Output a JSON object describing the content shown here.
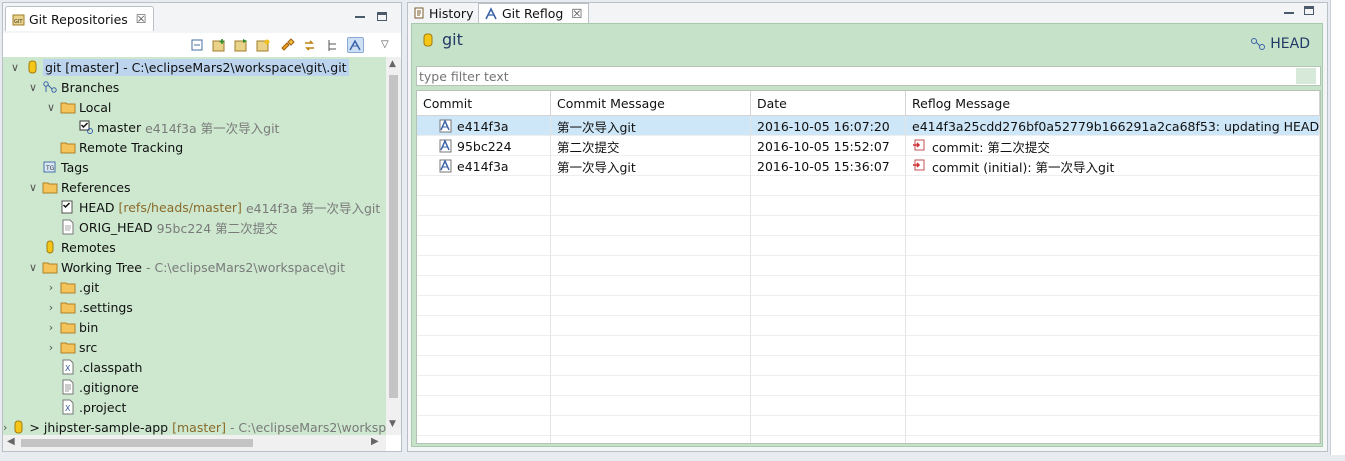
{
  "left_view": {
    "tab_title": "Git Repositories",
    "close_glyph": "☒",
    "toolbar_icons": [
      "collapse-all-icon",
      "add-repository-icon",
      "clone-repository-icon",
      "create-repository-icon",
      "link-with-editor-icon",
      "refresh-icon",
      "hierarchical-branch-icon",
      "link-selection-icon"
    ],
    "tree": [
      {
        "level": 0,
        "expander": "v",
        "icon": "repository-icon",
        "label": "git [master] - C:\\eclipseMars2\\workspace\\git\\.git",
        "decoration": "",
        "highlight": true
      },
      {
        "level": 1,
        "expander": "v",
        "icon": "branches-icon",
        "label": "Branches",
        "decoration": ""
      },
      {
        "level": 2,
        "expander": "v",
        "icon": "folder-icon",
        "label": "Local",
        "decoration": ""
      },
      {
        "level": 3,
        "expander": "",
        "icon": "checked-branch-icon",
        "label": "master",
        "decoration": "e414f3a 第一次导入git"
      },
      {
        "level": 2,
        "expander": "",
        "icon": "folder-icon",
        "label": "Remote Tracking",
        "decoration": ""
      },
      {
        "level": 1,
        "expander": "",
        "icon": "tags-icon",
        "label": "Tags",
        "decoration": ""
      },
      {
        "level": 1,
        "expander": "v",
        "icon": "folder-icon",
        "label": "References",
        "decoration": ""
      },
      {
        "level": 2,
        "expander": "",
        "icon": "checked-ref-icon",
        "label": "HEAD",
        "decoration_brown": "[refs/heads/master]",
        "decoration": "e414f3a 第一次导入git"
      },
      {
        "level": 2,
        "expander": "",
        "icon": "file-icon",
        "label": "ORIG_HEAD",
        "decoration": "95bc224 第二次提交"
      },
      {
        "level": 1,
        "expander": "",
        "icon": "remotes-icon",
        "label": "Remotes",
        "decoration": ""
      },
      {
        "level": 1,
        "expander": "v",
        "icon": "folder-icon",
        "label": "Working Tree",
        "decoration": "- C:\\eclipseMars2\\workspace\\git"
      },
      {
        "level": 2,
        "expander": ">",
        "icon": "folder-icon",
        "label": ".git",
        "decoration": ""
      },
      {
        "level": 2,
        "expander": ">",
        "icon": "folder-icon",
        "label": ".settings",
        "decoration": ""
      },
      {
        "level": 2,
        "expander": ">",
        "icon": "folder-icon",
        "label": "bin",
        "decoration": ""
      },
      {
        "level": 2,
        "expander": ">",
        "icon": "folder-icon",
        "label": "src",
        "decoration": ""
      },
      {
        "level": 2,
        "expander": "",
        "icon": "xml-file-icon",
        "label": ".classpath",
        "decoration": ""
      },
      {
        "level": 2,
        "expander": "",
        "icon": "text-file-icon",
        "label": ".gitignore",
        "decoration": ""
      },
      {
        "level": 2,
        "expander": "",
        "icon": "xml-file-icon",
        "label": ".project",
        "decoration": ""
      },
      {
        "level": 0,
        "expander": ">",
        "icon": "repository-icon",
        "label": "> jhipster-sample-app",
        "decoration_brown": "[master]",
        "decoration": "- C:\\eclipseMars2\\worksp"
      }
    ]
  },
  "right_view": {
    "tabs": [
      {
        "label": "History",
        "active": false
      },
      {
        "label": "Git Reflog",
        "active": true
      }
    ],
    "close_glyph": "☒",
    "form_title": "git",
    "head_label": "HEAD",
    "filter_placeholder": "type filter text",
    "columns": [
      "Commit",
      "Commit Message",
      "Date",
      "Reflog Message"
    ],
    "rows": [
      {
        "commit": "e414f3a",
        "message": "第一次导入git",
        "date": "2016-10-05 16:07:20",
        "reflog": "e414f3a25cdd276bf0a52779b166291a2ca68f53: updating HEAD",
        "reflog_icon": false,
        "selected": true
      },
      {
        "commit": "95bc224",
        "message": "第二次提交",
        "date": "2016-10-05 15:52:07",
        "reflog": "commit: 第二次提交",
        "reflog_icon": true,
        "selected": false
      },
      {
        "commit": "e414f3a",
        "message": "第一次导入git",
        "date": "2016-10-05 15:36:07",
        "reflog": "commit (initial): 第一次导入git",
        "reflog_icon": true,
        "selected": false
      }
    ]
  }
}
